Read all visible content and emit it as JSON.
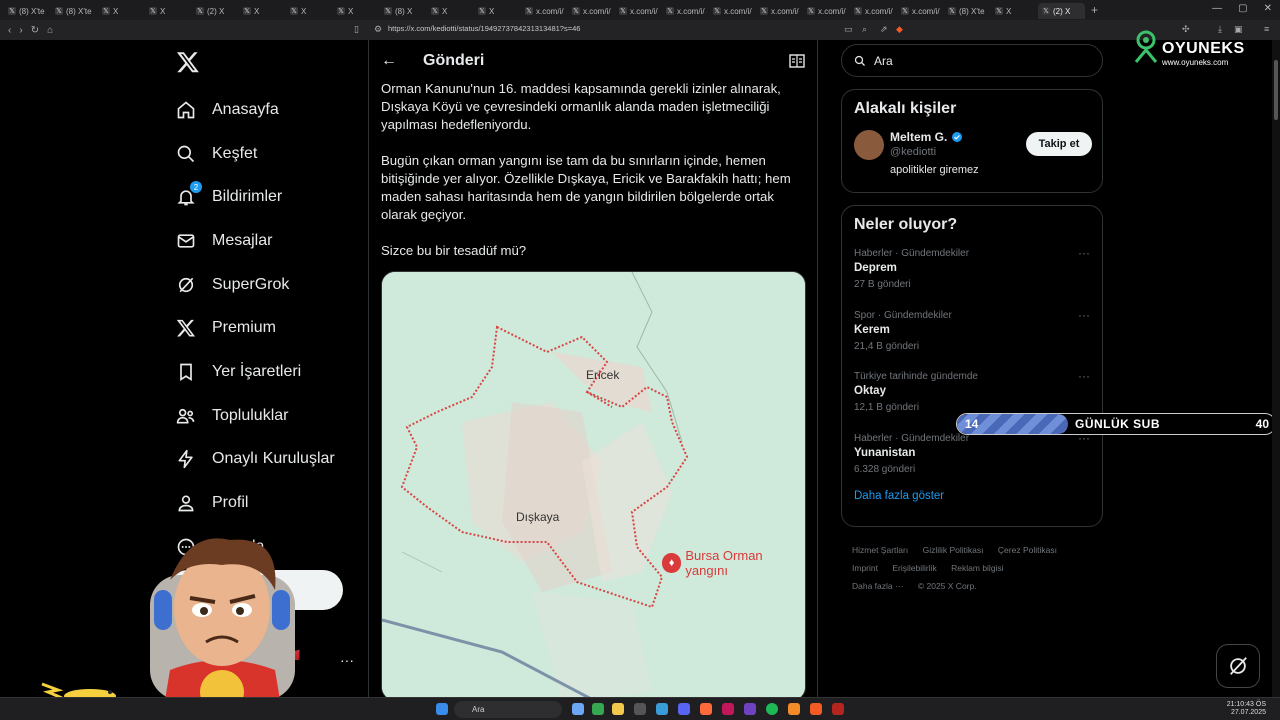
{
  "browser": {
    "tabs": [
      "(8) X'te",
      "(8) X'te",
      "X",
      "X",
      "(2) X",
      "X",
      "X",
      "X",
      "(8) X",
      "X",
      "X",
      "x.com/i/",
      "x.com/i/",
      "x.com/i/",
      "x.com/i/",
      "x.com/i/",
      "x.com/i/",
      "x.com/i/",
      "x.com/i/",
      "x.com/i/",
      "(8) X'te",
      "X",
      "(2) X"
    ],
    "url": "https://x.com/kediotti/status/1949273784231313481?s=46"
  },
  "nav": {
    "items": [
      {
        "label": "Anasayfa",
        "icon": "home-icon"
      },
      {
        "label": "Keşfet",
        "icon": "search-icon"
      },
      {
        "label": "Bildirimler",
        "icon": "bell-icon",
        "badge": "2"
      },
      {
        "label": "Mesajlar",
        "icon": "mail-icon"
      },
      {
        "label": "SuperGrok",
        "icon": "grok-icon"
      },
      {
        "label": "Premium",
        "icon": "x-icon"
      },
      {
        "label": "Yer İşaretleri",
        "icon": "bookmark-icon"
      },
      {
        "label": "Topluluklar",
        "icon": "people-icon"
      },
      {
        "label": "Onaylı Kuruluşlar",
        "icon": "lightning-icon"
      },
      {
        "label": "Profil",
        "icon": "person-icon"
      },
      {
        "label": "la",
        "icon": "more-circle-icon"
      }
    ],
    "post_button": "ınla",
    "account_name": "nli 🇮🇹",
    "account_handle": "TI",
    "account_more": "···"
  },
  "main": {
    "title": "Gönderi",
    "paragraphs": [
      "Orman Kanunu'nun 16. maddesi kapsamında gerekli izinler alınarak, Dışkaya Köyü ve çevresindeki ormanlık alanda maden işletmeciliği yapılması hedefleniyordu.",
      "Bugün çıkan orman yangını ise tam da bu sınırların içinde, hemen bitişiğinde yer alıyor. Özellikle Dışkaya, Ericik ve Barakfakih hattı; hem maden sahası haritasında hem de yangın bildirilen bölgelerde ortak olarak geçiyor.",
      "Sizce bu bir tesadüf mü?"
    ],
    "map": {
      "labels": {
        "ericek": "Ericek",
        "diskaya": "Dışkaya"
      },
      "fire_label": "Bursa Orman yangını"
    }
  },
  "right": {
    "search_placeholder": "Ara",
    "relevant": {
      "title": "Alakalı kişiler",
      "name": "Meltem G.",
      "handle": "@kediotti",
      "bio": "apolitikler giremez",
      "follow_label": "Takip et"
    },
    "trends": {
      "title": "Neler oluyor?",
      "items": [
        {
          "category": "Haberler · Gündemdekiler",
          "name": "Deprem",
          "count": "27 B gönderi"
        },
        {
          "category": "Spor · Gündemdekiler",
          "name": "Kerem",
          "count": "21,4 B gönderi"
        },
        {
          "category": "Türkiye tarihinde gündemde",
          "name": "Oktay",
          "count": "12,1 B gönderi"
        },
        {
          "category": "Haberler · Gündemdekiler",
          "name": "Yunanistan",
          "count": "6.328 gönderi"
        }
      ],
      "show_more": "Daha fazla göster"
    },
    "footer": {
      "links": [
        "Hizmet Şartları",
        "Gizlilik Politikası",
        "Çerez Politikası",
        "Imprint",
        "Erişilebilirlik",
        "Reklam bilgisi",
        "Daha fazla ···"
      ],
      "copyright": "© 2025 X Corp."
    }
  },
  "overlay": {
    "brand_name": "OYUNEKS",
    "brand_url": "www.oyuneks.com",
    "sub_current": "14",
    "sub_label": "GÜNLÜK SUB",
    "sub_goal": "40",
    "sub_fraction": 0.35
  },
  "taskbar": {
    "search": "Ara",
    "time": "21:10:43 ÖS",
    "date": "27.07.2025"
  },
  "colors": {
    "accent": "#1d9bf0",
    "fire": "#d93a3a",
    "map_bg": "#cfe9da"
  }
}
